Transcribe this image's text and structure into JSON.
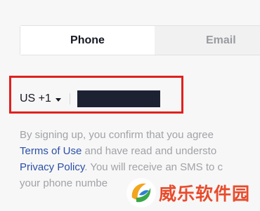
{
  "tabs": [
    {
      "label": "Phone",
      "active": true
    },
    {
      "label": "Email",
      "active": false
    }
  ],
  "phone": {
    "country_code": "US +1",
    "number_value": ""
  },
  "legal": {
    "line1": "By signing up, you confirm that you agree",
    "terms_link": "Terms of Use",
    "line2_rest": " and have read and understo",
    "privacy_link": "Privacy Policy",
    "line3_rest": ". You will receive an SMS to c",
    "line4": "your phone numbe"
  },
  "watermark": {
    "text": "威乐软件园"
  },
  "colors": {
    "highlight": "#e0211f",
    "link": "#2b4fa6",
    "masked_input": "#1d2233",
    "watermark": "#e94b2b"
  }
}
